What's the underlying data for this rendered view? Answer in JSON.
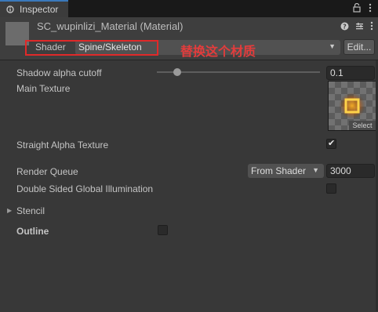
{
  "tab": {
    "label": "Inspector"
  },
  "material": {
    "title": "SC_wupinlizi_Material (Material)",
    "shader_label": "Shader",
    "shader_value": "Spine/Skeleton",
    "edit_label": "Edit..."
  },
  "annotation": {
    "text": "替换这个材质",
    "color": "#e33c3c"
  },
  "properties": {
    "shadow_alpha_cutoff": {
      "label": "Shadow alpha cutoff",
      "value": "0.1"
    },
    "main_texture": {
      "label": "Main Texture",
      "select_label": "Select"
    },
    "straight_alpha": {
      "label": "Straight Alpha Texture",
      "checked": true
    },
    "render_queue": {
      "label": "Render Queue",
      "dropdown": "From Shader",
      "value": "3000"
    },
    "double_sided_gi": {
      "label": "Double Sided Global Illumination",
      "checked": false
    },
    "stencil": {
      "label": "Stencil"
    },
    "outline": {
      "label": "Outline",
      "checked": false
    }
  },
  "icons": {
    "tab": "inspector-icon",
    "lock": "lock-icon",
    "menu": "kebab-menu-icon",
    "help": "help-icon",
    "settings": "preset-settings-icon"
  },
  "colors": {
    "accent": "#3a79bb",
    "background": "#383838",
    "highlight": "#e02929"
  }
}
